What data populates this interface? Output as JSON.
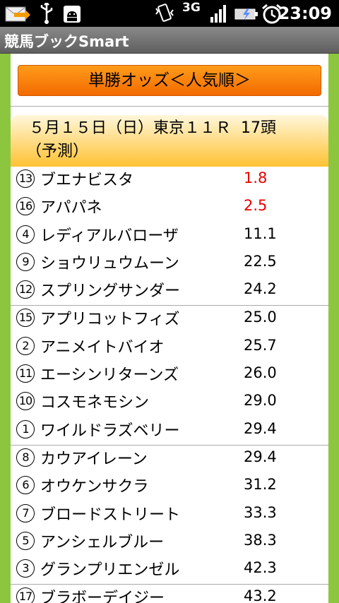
{
  "status": {
    "time": "23:09",
    "network": "3G"
  },
  "app": {
    "title": "競馬ブックSmart"
  },
  "header": {
    "button_label": "単勝オッズ＜人気順＞"
  },
  "race": {
    "info": "５月１５日（日）東京１１Ｒ",
    "count": "17頭",
    "note": "（予測）"
  },
  "horses": [
    {
      "num": "13",
      "name": "ブエナビスタ",
      "odds": "1.8",
      "hot": true
    },
    {
      "num": "16",
      "name": "アパパネ",
      "odds": "2.5",
      "hot": true
    },
    {
      "num": "4",
      "name": "レディアルバローザ",
      "odds": "11.1"
    },
    {
      "num": "9",
      "name": "ショウリュウムーン",
      "odds": "22.5"
    },
    {
      "num": "12",
      "name": "スプリングサンダー",
      "odds": "24.2"
    },
    {
      "num": "15",
      "name": "アプリコットフィズ",
      "odds": "25.0"
    },
    {
      "num": "2",
      "name": "アニメイトバイオ",
      "odds": "25.7"
    },
    {
      "num": "11",
      "name": "エーシンリターンズ",
      "odds": "26.0"
    },
    {
      "num": "10",
      "name": "コスモネモシン",
      "odds": "29.0"
    },
    {
      "num": "1",
      "name": "ワイルドラズベリー",
      "odds": "29.4"
    },
    {
      "num": "8",
      "name": "カウアイレーン",
      "odds": "29.4"
    },
    {
      "num": "6",
      "name": "オウケンサクラ",
      "odds": "31.2"
    },
    {
      "num": "7",
      "name": "ブロードストリート",
      "odds": "33.3"
    },
    {
      "num": "5",
      "name": "アンシェルブルー",
      "odds": "38.3"
    },
    {
      "num": "3",
      "name": "グランプリエンゼル",
      "odds": "42.3"
    },
    {
      "num": "17",
      "name": "ブラボーデイジー",
      "odds": "43.2"
    }
  ],
  "colors": {
    "accent": "#f26a00",
    "hot_odds": "#e60000",
    "background": "#8cc63f"
  }
}
